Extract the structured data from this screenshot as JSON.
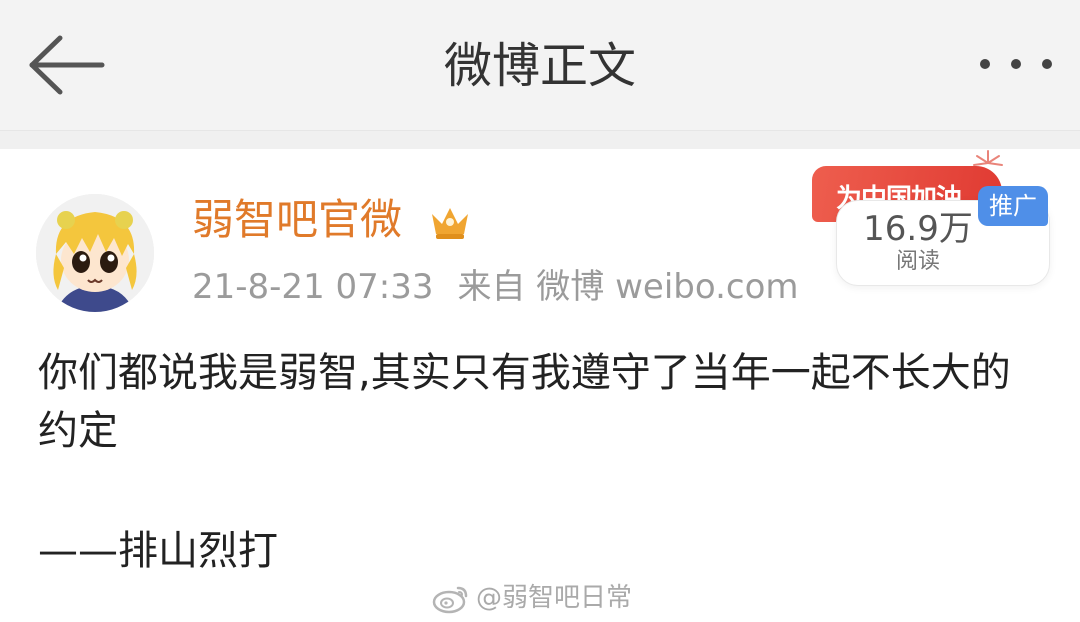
{
  "header": {
    "title": "微博正文",
    "back_icon": "arrow-left-icon",
    "more_icon": "more-horizontal-icon"
  },
  "post": {
    "author": {
      "name": "弱智吧官微",
      "avatar": "anime-girl-avatar",
      "badge_icon": "vip-crown-icon"
    },
    "time": "21-8-21 07:33",
    "source": "来自 微博 weibo.com",
    "content": "你们都说我是弱智,其实只有我遵守了当年一起不长大的约定",
    "signature": "——排山烈打"
  },
  "promo": {
    "banner": "为中国加油",
    "count": "16.9万",
    "count_label": "阅读",
    "tag": "推广"
  },
  "watermark": {
    "icon": "weibo-logo-icon",
    "text": "@弱智吧日常"
  },
  "colors": {
    "accent_orange": "#e07a2a",
    "banner_red": "#e03a32",
    "tag_blue": "#4f8fe8",
    "header_bg": "#f3f3f3"
  }
}
